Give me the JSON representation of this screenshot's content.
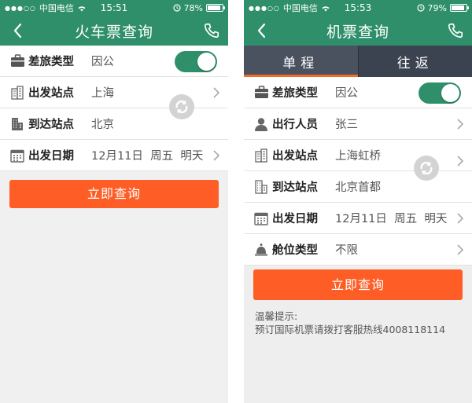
{
  "colors": {
    "brand_green": "#2e8f6a",
    "query_orange": "#fe5e26",
    "tab_dark": "#3c4350",
    "tab_indicator": "#f36b2a"
  },
  "train_screen": {
    "status": {
      "signal": "●●●○○",
      "carrier": "中国电信",
      "time": "15:51",
      "battery_pct": "78%",
      "battery_level": 0.78
    },
    "nav": {
      "title": "火车票查询",
      "back_icon": "chevron-left-icon",
      "phone_icon": "phone-icon"
    },
    "rows": {
      "trip_type": {
        "label": "差旅类型",
        "value": "因公",
        "toggle_on": true,
        "icon": "briefcase-icon"
      },
      "depart": {
        "label": "出发站点",
        "value": "上海",
        "icon": "building-icon"
      },
      "arrive": {
        "label": "到达站点",
        "value": "北京",
        "icon": "building-icon"
      },
      "date": {
        "label": "出发日期",
        "value": "12月11日  周五  明天",
        "icon": "calendar-icon"
      }
    },
    "query_label": "立即查询"
  },
  "flight_screen": {
    "status": {
      "signal": "●●●○○",
      "carrier": "中国电信",
      "time": "15:53",
      "battery_pct": "79%",
      "battery_level": 0.79
    },
    "nav": {
      "title": "机票查询",
      "back_icon": "chevron-left-icon",
      "phone_icon": "phone-icon"
    },
    "tabs": [
      {
        "label": "单程",
        "active": true
      },
      {
        "label": "往返",
        "active": false
      }
    ],
    "rows": {
      "trip_type": {
        "label": "差旅类型",
        "value": "因公",
        "toggle_on": true,
        "icon": "briefcase-icon"
      },
      "traveler": {
        "label": "出行人员",
        "value": "张三",
        "icon": "person-icon"
      },
      "depart": {
        "label": "出发站点",
        "value": "上海虹桥",
        "icon": "building-icon"
      },
      "arrive": {
        "label": "到达站点",
        "value": "北京首都",
        "icon": "building-icon"
      },
      "date": {
        "label": "出发日期",
        "value": "12月11日  周五  明天",
        "icon": "calendar-icon"
      },
      "cabin": {
        "label": "舱位类型",
        "value": "不限",
        "icon": "bell-icon"
      }
    },
    "query_label": "立即查询",
    "hint_title": "温馨提示:",
    "hint_text": "预订国际机票请拨打客服热线4008118114"
  }
}
